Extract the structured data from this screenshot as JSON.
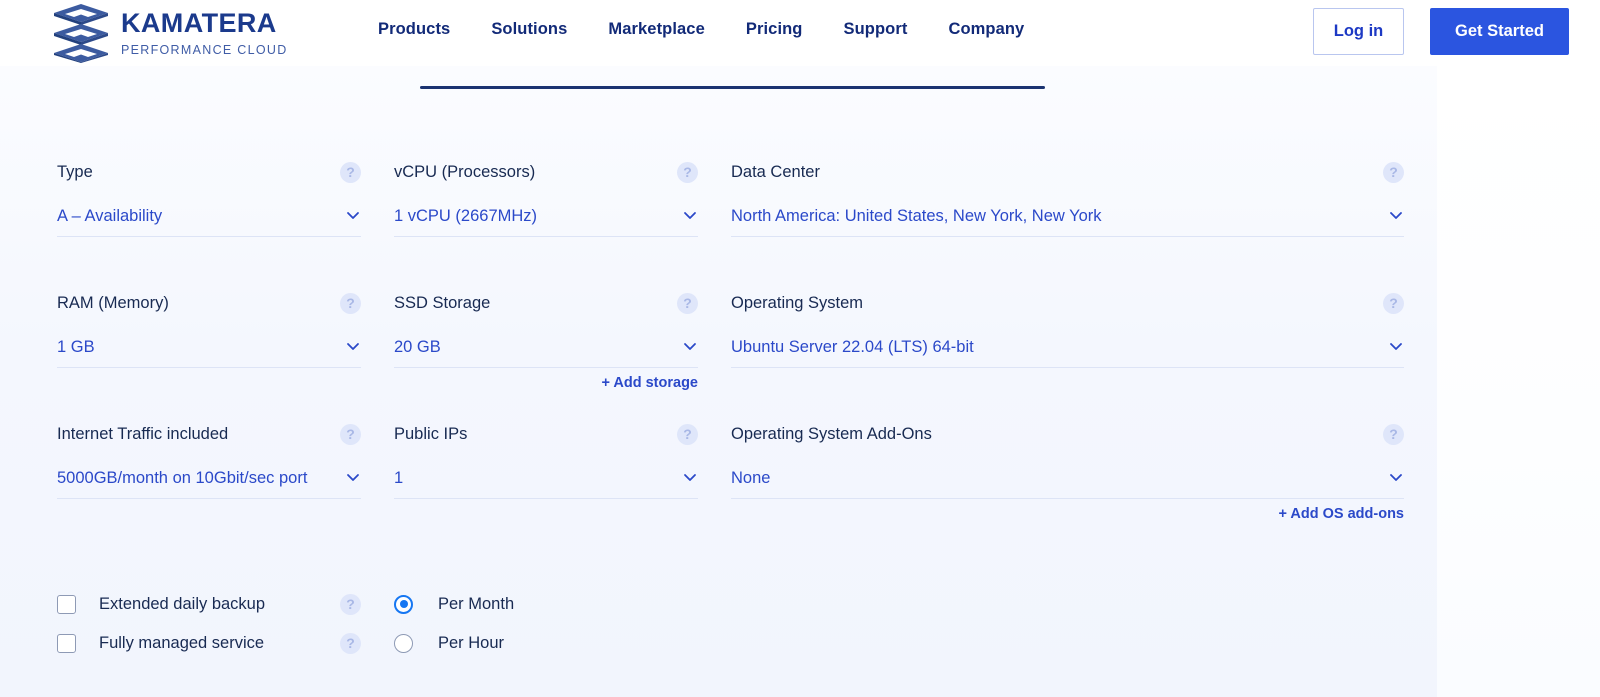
{
  "header": {
    "logo": {
      "icon": "kamatera-stacked-hex-logo",
      "title": "KAMATERA",
      "subtitle": "PERFORMANCE CLOUD"
    },
    "nav_items": [
      {
        "label": "Products"
      },
      {
        "label": "Solutions"
      },
      {
        "label": "Marketplace"
      },
      {
        "label": "Pricing"
      },
      {
        "label": "Support"
      },
      {
        "label": "Company"
      }
    ],
    "login_label": "Log in",
    "get_started_label": "Get Started"
  },
  "colors": {
    "brand_navy": "#122a78",
    "brand_blue": "#2b49c9",
    "cta_blue": "#2b55e0",
    "radio_blue": "#1677f2",
    "divider": "#dde4f6",
    "help_bg": "#dfe6fa",
    "panel_edge": "#1b3371"
  },
  "configurator": {
    "help_icon": "question-mark-icon",
    "chevron_icon": "chevron-down-icon",
    "fields": [
      {
        "id": "type",
        "label": "Type",
        "value": "A – Availability",
        "column": 0,
        "row": 0
      },
      {
        "id": "vcpu",
        "label": "vCPU (Processors)",
        "value": "1 vCPU (2667MHz)",
        "column": 1,
        "row": 0
      },
      {
        "id": "data-center",
        "label": "Data Center",
        "value": "North America: United States, New York, New York",
        "column": 2,
        "row": 0
      },
      {
        "id": "ram",
        "label": "RAM (Memory)",
        "value": "1 GB",
        "column": 0,
        "row": 1
      },
      {
        "id": "ssd-storage",
        "label": "SSD Storage",
        "value": "20 GB",
        "column": 1,
        "row": 1
      },
      {
        "id": "operating-system",
        "label": "Operating System",
        "value": "Ubuntu Server 22.04 (LTS) 64-bit",
        "column": 2,
        "row": 1
      },
      {
        "id": "internet-traffic",
        "label": "Internet Traffic included",
        "value": "5000GB/month on 10Gbit/sec port",
        "column": 0,
        "row": 2
      },
      {
        "id": "public-ips",
        "label": "Public IPs",
        "value": "1",
        "column": 1,
        "row": 2
      },
      {
        "id": "os-addons",
        "label": "Operating System Add-Ons",
        "value": "None",
        "column": 2,
        "row": 2
      }
    ],
    "add_storage_label": "+ Add storage",
    "add_os_addons_label": "+ Add OS add-ons",
    "checkboxes": [
      {
        "id": "extended-daily-backup",
        "label": "Extended daily backup",
        "checked": false
      },
      {
        "id": "fully-managed-service",
        "label": "Fully managed service",
        "checked": false
      }
    ],
    "billing_options": [
      {
        "id": "per-month",
        "label": "Per Month",
        "selected": true
      },
      {
        "id": "per-hour",
        "label": "Per Hour",
        "selected": false
      }
    ]
  }
}
